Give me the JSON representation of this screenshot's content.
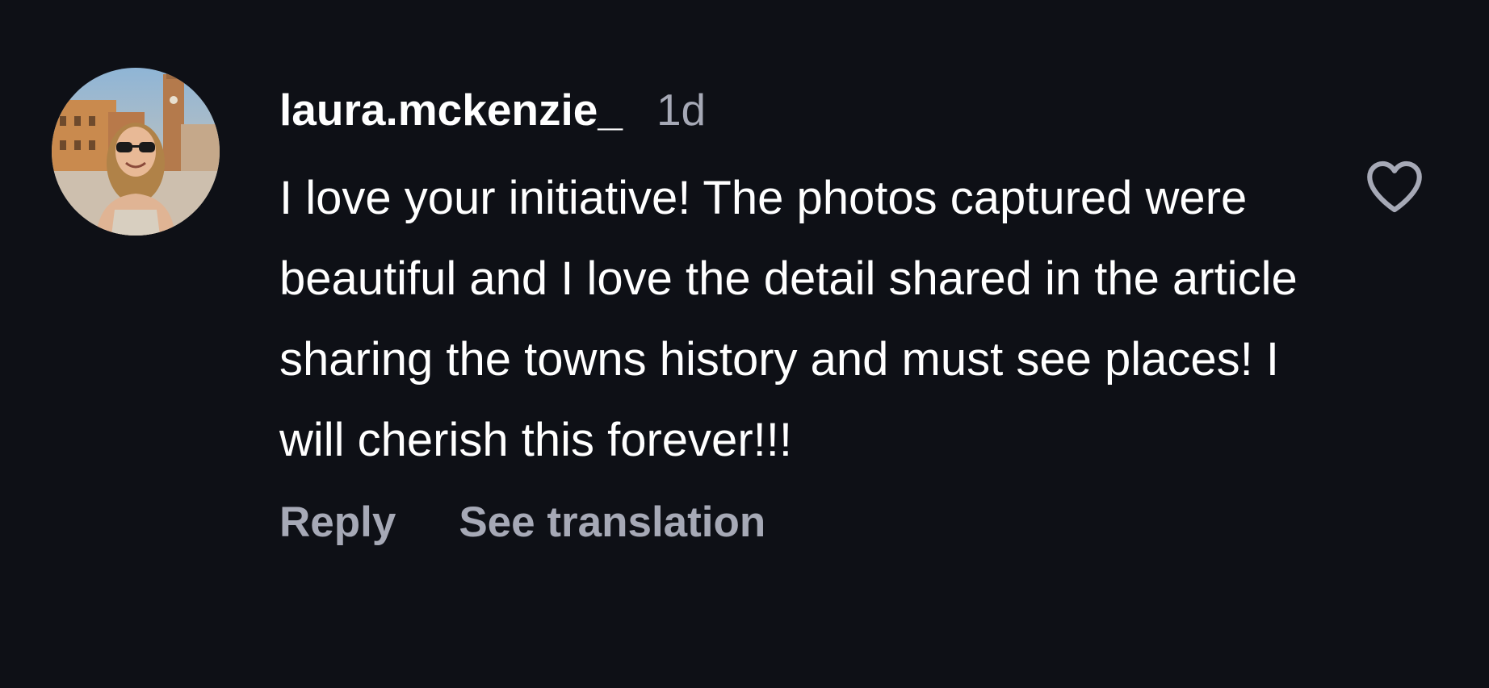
{
  "comment": {
    "username": "laura.mckenzie_",
    "time_ago": "1d",
    "text": "I love your initiative! The photos captured were beautiful and I love the detail shared in the article sharing the towns history and must see places! I will cherish this forever!!!",
    "avatar_icon": "user-photo-avatar",
    "like_icon": "heart-outline-icon"
  },
  "actions": {
    "reply_label": "Reply",
    "translation_label": "See translation"
  },
  "colors": {
    "background": "#0e1016",
    "primary_text": "#ffffff",
    "secondary_text": "#a6a9b6"
  }
}
